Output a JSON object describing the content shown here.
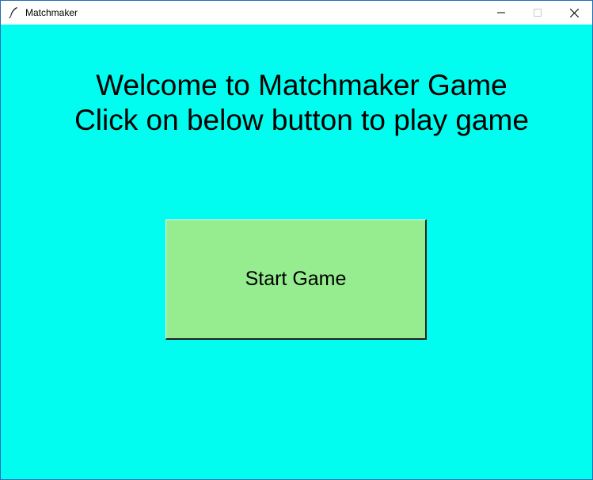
{
  "window": {
    "title": "Matchmaker",
    "app_icon": "feather-icon",
    "controls": {
      "minimize_icon": "minimize-icon",
      "maximize_icon": "maximize-icon",
      "close_icon": "close-icon"
    }
  },
  "main": {
    "welcome_line1": "Welcome to Matchmaker Game",
    "welcome_line2": "Click on below button to play game",
    "start_button_label": "Start Game"
  },
  "colors": {
    "background": "#00fdef",
    "button": "#95ed8f",
    "titlebar": "#ffffff"
  }
}
